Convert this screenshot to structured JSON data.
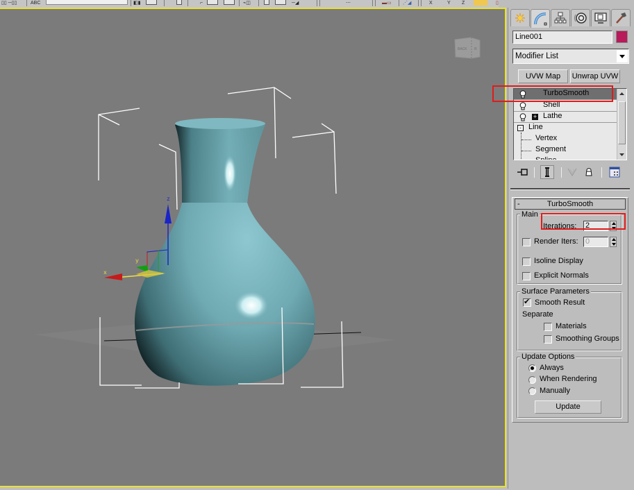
{
  "toolbar": {
    "abc_label": "ABC",
    "snap_label": "%"
  },
  "viewport": {
    "viewcube_label": "BACK",
    "viewcube_side_label": "R",
    "gizmo_axes": {
      "x": "x",
      "y": "y",
      "z": "z"
    },
    "object_color": "#6fa9b2",
    "border_color": "#e8e12f"
  },
  "command_panel": {
    "tabs": [
      {
        "name": "create",
        "icon": "sun-star-icon"
      },
      {
        "name": "modify",
        "icon": "curve-bend-icon",
        "active": true
      },
      {
        "name": "hierarchy",
        "icon": "hierarchy-icon"
      },
      {
        "name": "motion",
        "icon": "motion-disc-icon"
      },
      {
        "name": "display",
        "icon": "monitor-icon"
      },
      {
        "name": "utilities",
        "icon": "hammer-icon"
      }
    ],
    "object_name": "Line001",
    "object_color": "#b81a5a",
    "modifier_list": "Modifier List",
    "buttons": {
      "uvw_map": "UVW Map",
      "unwrap_uvw": "Unwrap UVW"
    },
    "stack": [
      {
        "label": "TurboSmooth",
        "selected": true,
        "bulb": true
      },
      {
        "label": "Shell",
        "bulb": true
      },
      {
        "label": "Lathe",
        "bulb": true,
        "expand": "+"
      },
      {
        "label": "Line",
        "expand": "-"
      },
      {
        "label": "Vertex",
        "child": true
      },
      {
        "label": "Segment",
        "child": true
      },
      {
        "label": "Spline",
        "child": true
      }
    ],
    "stack_tools": [
      "pin-stack-icon",
      "show-end-result-icon",
      "make-unique-icon",
      "remove-modifier-icon",
      "configure-sets-icon"
    ],
    "rollout": {
      "title": "TurboSmooth",
      "collapse": "-",
      "main_group": "Main",
      "iterations_label": "Iterations:",
      "iterations_value": "2",
      "render_iters_label": "Render Iters:",
      "render_iters_value": "0",
      "render_iters_checked": false,
      "isoline_label": "Isoline Display",
      "isoline_checked": false,
      "explicit_normals_label": "Explicit Normals",
      "explicit_normals_checked": false,
      "surface_group": "Surface Parameters",
      "smooth_result_label": "Smooth Result",
      "smooth_result_checked": true,
      "separate_label": "Separate",
      "materials_label": "Materials",
      "materials_checked": false,
      "smoothing_groups_label": "Smoothing Groups",
      "smoothing_groups_checked": false,
      "update_group": "Update Options",
      "update_options": [
        {
          "label": "Always",
          "selected": true
        },
        {
          "label": "When Rendering",
          "selected": false
        },
        {
          "label": "Manually",
          "selected": false
        }
      ],
      "update_button": "Update"
    }
  },
  "annotations": {
    "highlight_color": "#e01b1b"
  }
}
